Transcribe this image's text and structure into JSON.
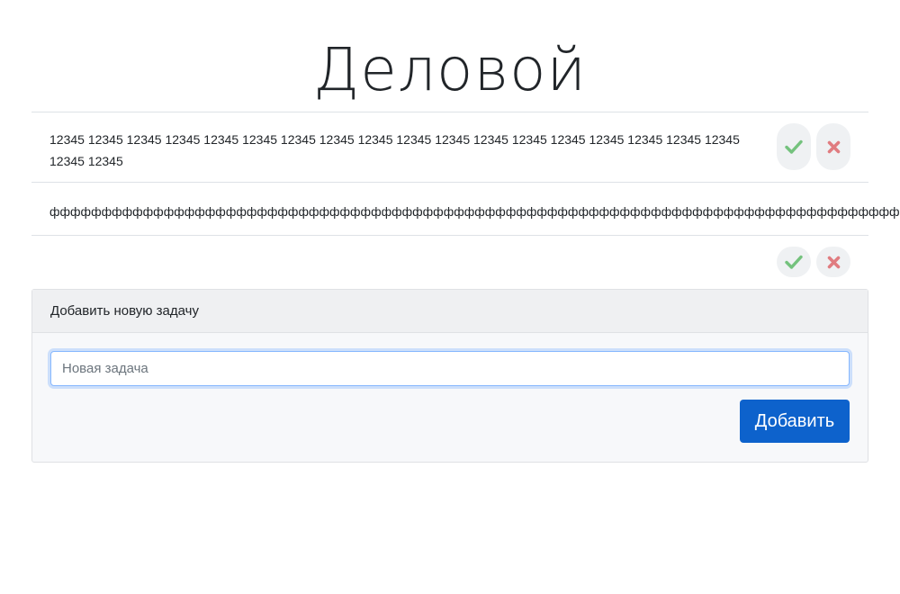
{
  "page": {
    "title": "Деловой"
  },
  "tasks": [
    {
      "text": "12345 12345 12345 12345 12345 12345 12345 12345 12345 12345 12345 12345 12345 12345 12345 12345 12345 12345 12345 12345",
      "actions": [
        "check-icon",
        "close-icon"
      ]
    },
    {
      "text": "фффффффффффффффффффффффффффффффффффффффффффффффффффффффффффффффффффффффффффффффффффффффффффффф",
      "actions": []
    },
    {
      "text": "",
      "actions": [
        "check-icon",
        "close-icon"
      ]
    }
  ],
  "colors": {
    "check": "#74c27d",
    "close": "#e07c80",
    "button_primary": "#0d62cc"
  },
  "add_form": {
    "header": "Добавить новую задачу",
    "input_value": "",
    "input_placeholder": "Новая задача",
    "button_label": "Добавить"
  }
}
